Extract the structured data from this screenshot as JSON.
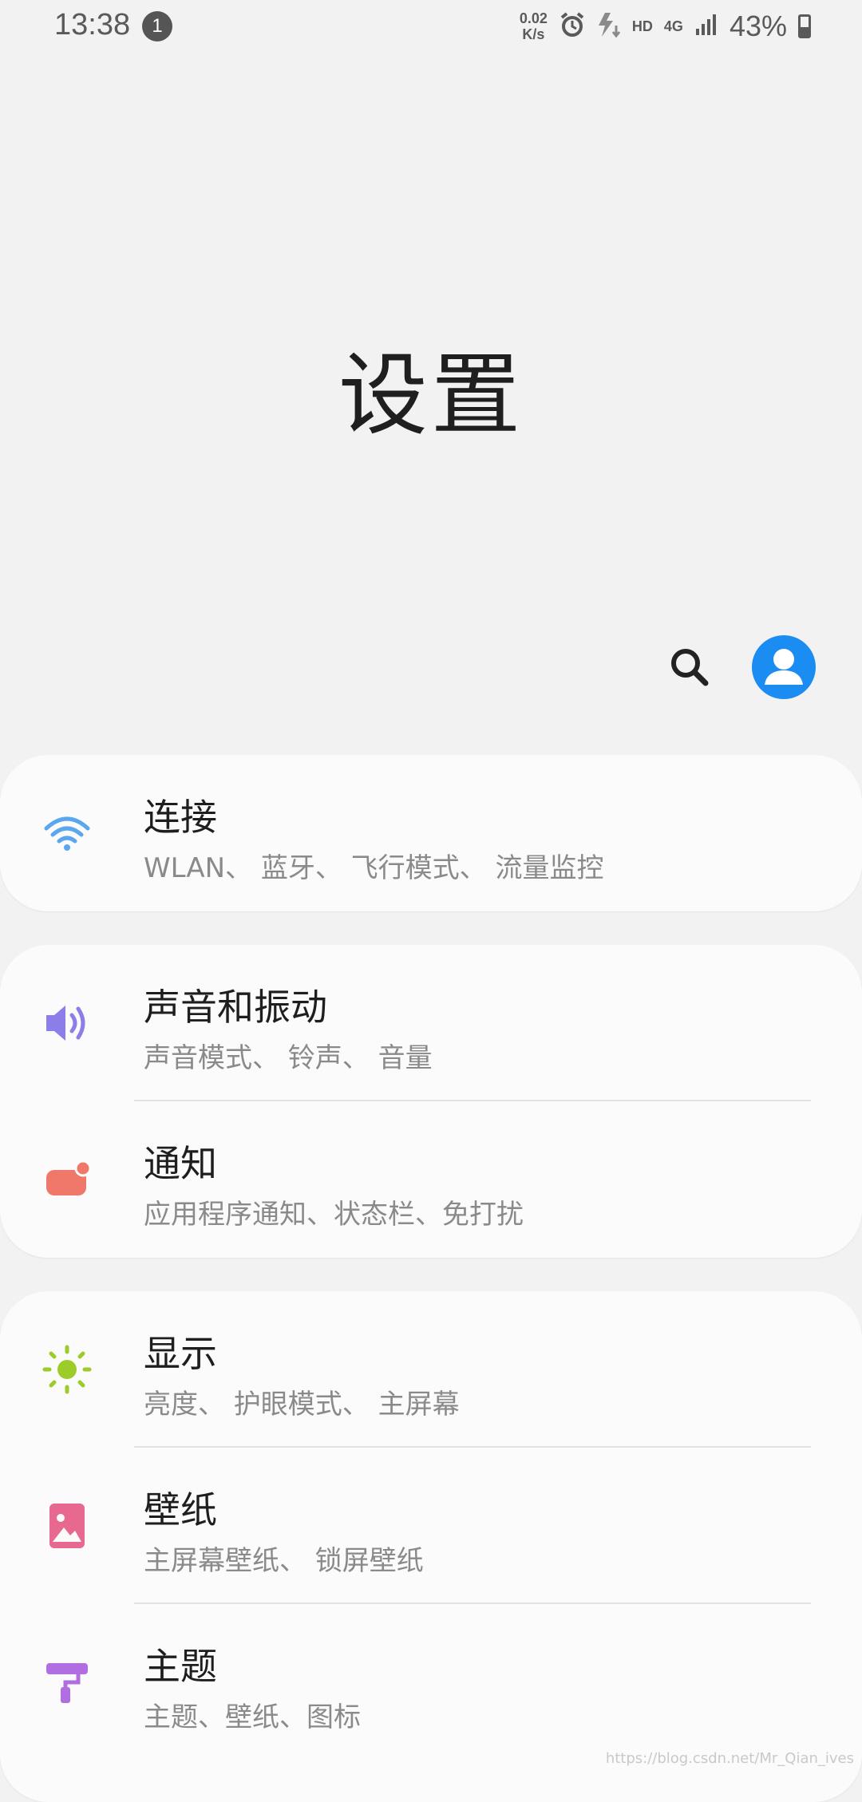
{
  "status_bar": {
    "time": "13:38",
    "notification_count": "1",
    "net_speed_value": "0.02",
    "net_speed_unit": "K/s",
    "hd_label": "HD",
    "network_label": "4G",
    "battery_percent": "43%",
    "icons": [
      "alarm-icon",
      "charging-icon",
      "signal-icon",
      "battery-icon"
    ]
  },
  "page": {
    "title": "设置"
  },
  "header_actions": {
    "icons": [
      "search-icon",
      "account-avatar-icon"
    ],
    "avatar_color": "#1a8cf2"
  },
  "cards": [
    {
      "items": [
        {
          "title": "连接",
          "subtitle": "WLAN、 蓝牙、 飞行模式、 流量监控",
          "icon": "wifi-icon",
          "icon_color": "#5aa6ef"
        }
      ]
    },
    {
      "items": [
        {
          "title": "声音和振动",
          "subtitle": "声音模式、 铃声、 音量",
          "icon": "volume-icon",
          "icon_color": "#8b7ee8"
        },
        {
          "title": "通知",
          "subtitle": "应用程序通知、状态栏、免打扰",
          "icon": "notification-icon",
          "icon_color": "#f0786a"
        }
      ]
    },
    {
      "items": [
        {
          "title": "显示",
          "subtitle": "亮度、 护眼模式、 主屏幕",
          "icon": "brightness-icon",
          "icon_color": "#9ccc2a"
        },
        {
          "title": "壁纸",
          "subtitle": "主屏幕壁纸、 锁屏壁纸",
          "icon": "wallpaper-icon",
          "icon_color": "#e8698f"
        },
        {
          "title": "主题",
          "subtitle": "主题、壁纸、图标",
          "icon": "theme-brush-icon",
          "icon_color": "#b16ee0"
        }
      ]
    }
  ],
  "watermark": "https://blog.csdn.net/Mr_Qian_ives"
}
